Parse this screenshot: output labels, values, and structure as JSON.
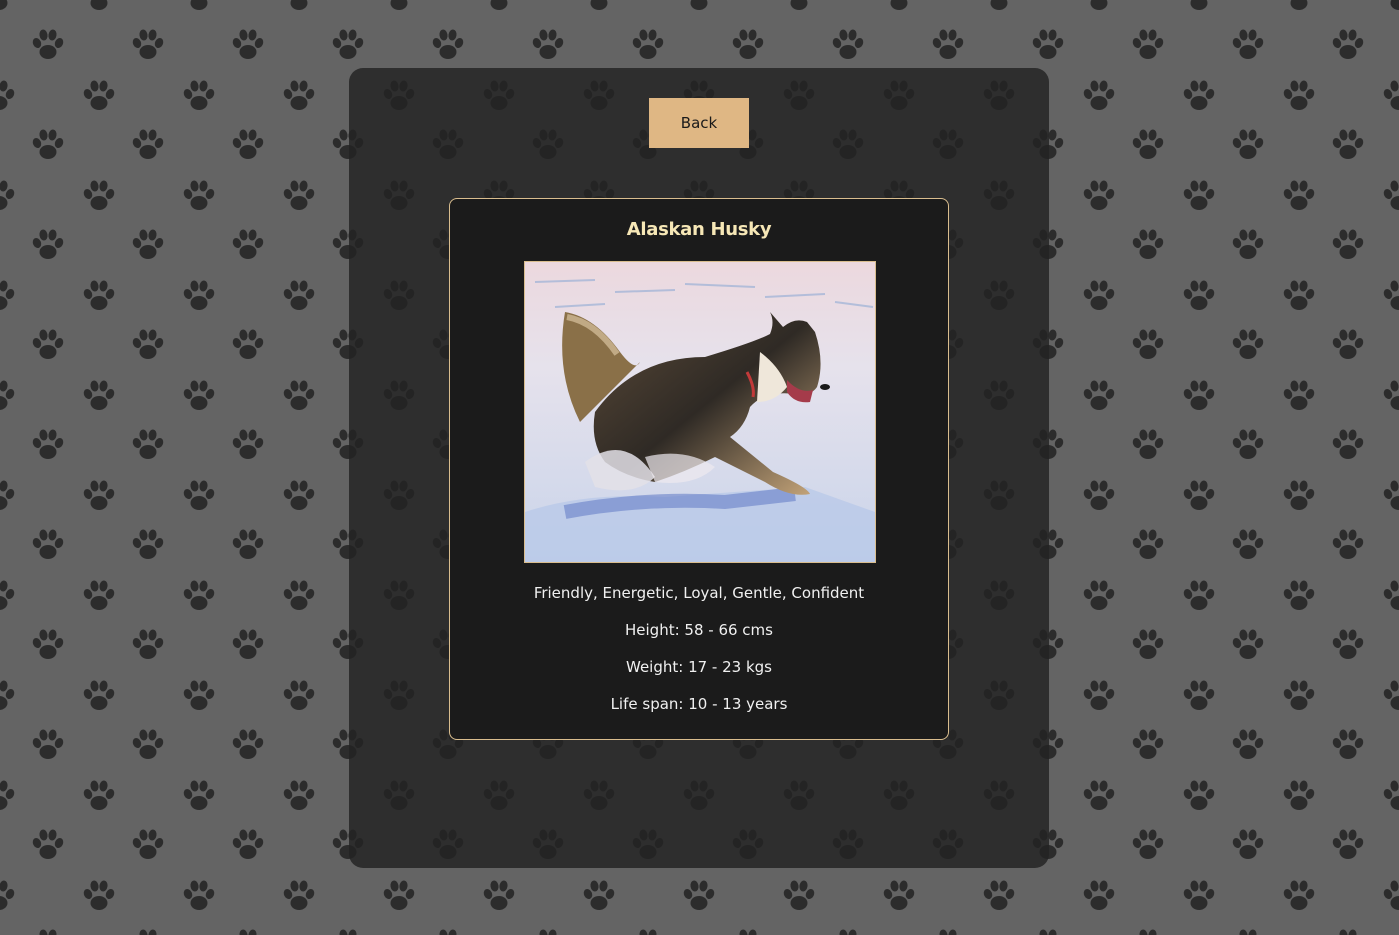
{
  "page": {
    "background_color": "#646464",
    "pattern_icon": "paw-print-icon"
  },
  "back_button": {
    "label": "Back",
    "color": "#dfb784"
  },
  "breed": {
    "name": "Alaskan Husky",
    "image_subject": "husky running in snow",
    "temperament": "Friendly, Energetic, Loyal, Gentle, Confident",
    "height": "Height: 58 - 66 cms",
    "weight": "Weight: 17 - 23 kgs",
    "life_span": "Life span: 10 - 13 years"
  },
  "colors": {
    "card_border": "#d9bd8e",
    "title": "#f6e7b6",
    "panel": "#222222"
  }
}
